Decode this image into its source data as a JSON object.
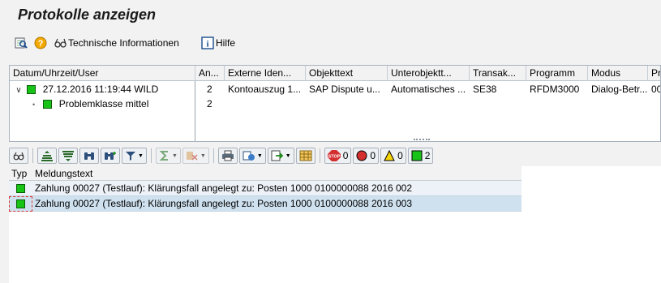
{
  "window": {
    "title": "Protokolle anzeigen"
  },
  "toolbar": {
    "technical_info_label": "Technische Informationen",
    "help_label": "Hilfe"
  },
  "tree": {
    "columns": [
      "Datum/Uhrzeit/User",
      "An...",
      "Externe Iden...",
      "Objekttext",
      "Unterobjektt...",
      "Transak...",
      "Programm",
      "Modus",
      "Pr"
    ],
    "rows": [
      {
        "label": "27.12.2016  11:19:44  WILD",
        "count": "2",
        "external_id": "Kontoauszug 1...",
        "object_text": "SAP Dispute u...",
        "subobject_text": "Automatisches ...",
        "transaction": "SE38",
        "program": "RFDM3000",
        "mode": "Dialog-Betr...",
        "pr": "00",
        "status_color": "#17c317"
      },
      {
        "label": "Problemklasse mittel",
        "count": "2",
        "status_color": "#17c317"
      }
    ]
  },
  "msgbar": {
    "counts": {
      "stop": "0",
      "error": "0",
      "warning": "0",
      "success": "2"
    }
  },
  "messages": {
    "columns": [
      "Typ",
      "Meldungstext"
    ],
    "rows": [
      {
        "text": "Zahlung 00027 (Testlauf): Klärungsfall angelegt zu: Posten 1000 0100000088 2016 002"
      },
      {
        "text": "Zahlung 00027 (Testlauf): Klärungsfall angelegt zu: Posten 1000 0100000088 2016 003"
      }
    ]
  }
}
